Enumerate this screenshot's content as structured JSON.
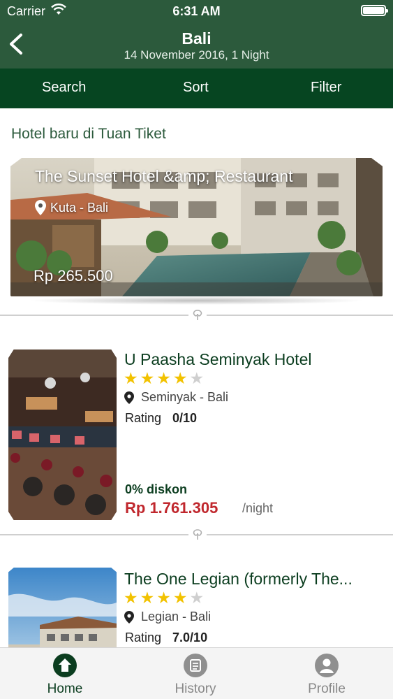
{
  "status_bar": {
    "carrier": "Carrier",
    "time": "6:31 AM"
  },
  "header": {
    "title": "Bali",
    "subtitle": "14 November 2016, 1 Night"
  },
  "toolbar": {
    "search": "Search",
    "sort": "Sort",
    "filter": "Filter"
  },
  "section_title": "Hotel baru di Tuan Tiket",
  "featured": {
    "name": "The Sunset Hotel &amp; Restaurant",
    "location": "Kuta - Bali",
    "price": "Rp 265.500"
  },
  "hotels": [
    {
      "name": "U Paasha Seminyak Hotel",
      "stars": 4,
      "max_stars": 5,
      "location": "Seminyak - Bali",
      "rating_label": "Rating",
      "rating_value": "0/10",
      "discount": "0% diskon",
      "price": "Rp 1.761.305",
      "per": "/night"
    },
    {
      "name": "The One Legian (formerly The...",
      "stars": 4,
      "max_stars": 5,
      "location": "Legian - Bali",
      "rating_label": "Rating",
      "rating_value": "7.0/10"
    }
  ],
  "tabs": [
    {
      "label": "Home",
      "icon": "home-icon",
      "active": true
    },
    {
      "label": "History",
      "icon": "history-icon",
      "active": false
    },
    {
      "label": "Profile",
      "icon": "profile-icon",
      "active": false
    }
  ],
  "colors": {
    "header_bg": "#2c5a3c",
    "toolbar_bg": "#064521",
    "accent_green": "#0b3d1f",
    "price_red": "#c0272d",
    "star_yellow": "#f2c200"
  }
}
